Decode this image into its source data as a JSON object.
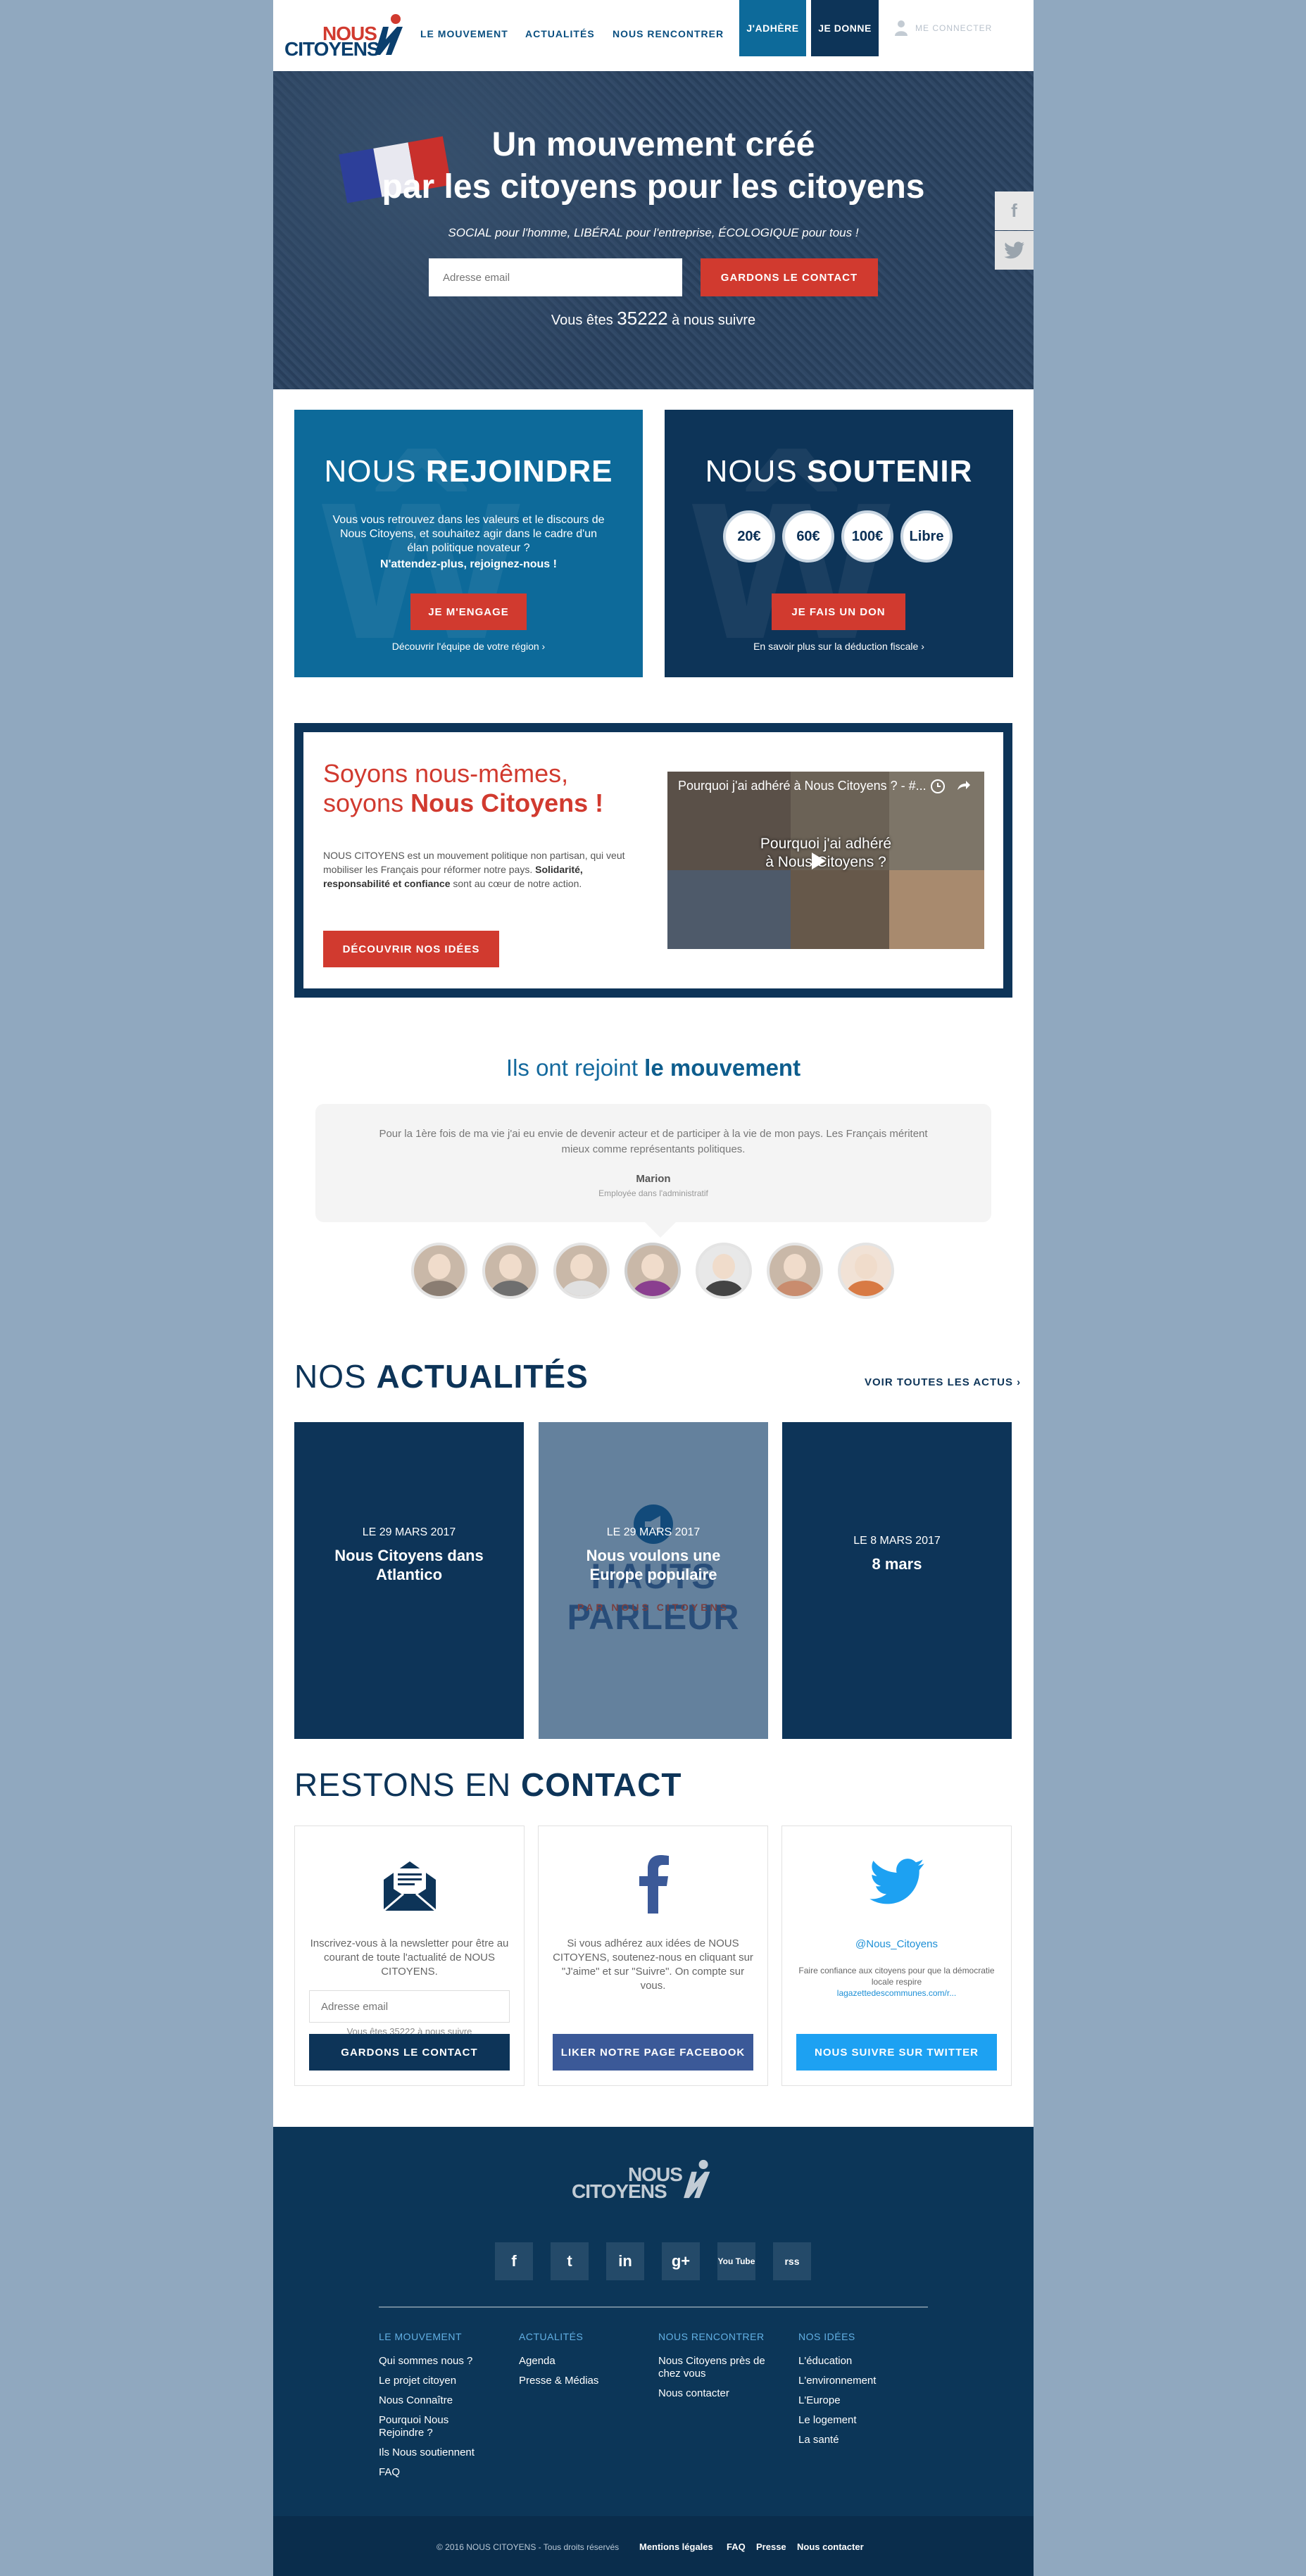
{
  "nav": {
    "logo_line1": "NOUS",
    "logo_line2": "CITOYENS",
    "links": [
      "LE MOUVEMENT",
      "ACTUALITÉS",
      "NOUS RENCONTRER"
    ],
    "adhere": "J'ADHÈRE",
    "donne": "JE DONNE",
    "login": "ME CONNECTER"
  },
  "hero": {
    "title_line1": "Un mouvement créé",
    "title_line2": "par les citoyens pour les citoyens",
    "subtitle": "SOCIAL pour l'homme, LIBÉRAL pour l'entreprise, ÉCOLOGIQUE pour tous !",
    "email_placeholder": "Adresse email",
    "cta": "GARDONS LE CONTACT",
    "count_prefix": "Vous êtes",
    "count": "35222",
    "count_suffix": "à nous suivre"
  },
  "share": {
    "facebook": "f",
    "twitter": "t"
  },
  "join": {
    "title_light": "NOUS",
    "title_bold": "REJOINDRE",
    "text": "Vous vous retrouvez dans les valeurs et le discours de Nous Citoyens, et souhaitez agir dans le cadre d'un élan politique novateur ?",
    "emphasis": "N'attendez-plus, rejoignez-nous !",
    "button": "JE M'ENGAGE",
    "link": "Découvrir l'équipe de votre région ›"
  },
  "support": {
    "title_light": "NOUS",
    "title_bold": "SOUTENIR",
    "amounts": [
      "20€",
      "60€",
      "100€",
      "Libre"
    ],
    "button": "JE FAIS UN DON",
    "link": "En savoir plus sur la déduction fiscale ›"
  },
  "intro": {
    "title_line1": "Soyons nous-mêmes,",
    "title_line2_light": "soyons",
    "title_line2_bold": "Nous Citoyens !",
    "text": "NOUS CITOYENS est un mouvement politique non partisan, qui veut mobiliser les Français pour réformer notre pays.",
    "text_bold": "Solidarité, responsabilité et confiance",
    "text_end": "sont au cœur de notre action.",
    "button": "DÉCOUVRIR NOS IDÉES",
    "video_title": "Pourquoi j'ai adhéré à Nous Citoyens ? - #...",
    "video_center_1": "Pourquoi j'ai adhéré",
    "video_center_2": "à Nous Citoyens ?"
  },
  "testimonials": {
    "title_light": "Ils ont rejoint",
    "title_bold": "le mouvement",
    "quote": "Pour la 1ère fois de ma vie j'ai eu envie de devenir acteur et de participer à la vie de mon pays. Les Français méritent mieux comme représentants politiques.",
    "name": "Marion",
    "role": "Employée dans l'administratif"
  },
  "news": {
    "title_light": "NOS",
    "title_bold": "ACTUALITÉS",
    "see_all": "VOIR TOUTES LES ACTUS ›",
    "items": [
      {
        "date": "LE 29 MARS 2017",
        "title": "Nous Citoyens dans Atlantico"
      },
      {
        "date": "LE 29 MARS 2017",
        "title": "Nous voulons une Europe populaire",
        "watermark": "HAUTS PARLEUR",
        "watermark_sub": "PAR NOUS CITOYENS"
      },
      {
        "date": "LE 8 MARS 2017",
        "title": "8 mars"
      }
    ]
  },
  "contact": {
    "title_light": "RESTONS EN",
    "title_bold": "CONTACT",
    "newsletter_text": "Inscrivez-vous à la newsletter pour être au courant de toute l'actualité de NOUS CITOYENS.",
    "email_placeholder": "Adresse email",
    "newsletter_count": "Vous êtes 35222 à nous suivre",
    "newsletter_button": "GARDONS LE CONTACT",
    "facebook_text": "Si vous adhérez aux idées de NOUS CITOYENS, soutenez-nous en cliquant sur \"J'aime\" et sur \"Suivre\". On compte sur vous.",
    "facebook_button": "LIKER NOTRE PAGE FACEBOOK",
    "twitter_handle": "@Nous_Citoyens",
    "twitter_text": "Faire confiance aux citoyens pour que la démocratie locale respire",
    "twitter_link": "lagazettedescommunes.com/r...",
    "twitter_button": "NOUS SUIVRE SUR TWITTER"
  },
  "footer": {
    "social": [
      "f",
      "t",
      "in",
      "g+",
      "You Tube",
      "rss"
    ],
    "columns": [
      {
        "heading": "LE MOUVEMENT",
        "items": [
          "Qui sommes nous ?",
          "Le projet citoyen",
          "Nous Connaître",
          "Pourquoi Nous Rejoindre ?",
          "Ils Nous soutiennent",
          "FAQ"
        ]
      },
      {
        "heading": "ACTUALITÉS",
        "items": [
          "Agenda",
          "Presse & Médias"
        ]
      },
      {
        "heading": "NOUS RENCONTRER",
        "items": [
          "Nous Citoyens près de chez vous",
          "Nous contacter"
        ]
      },
      {
        "heading": "NOS IDÉES",
        "items": [
          "L'éducation",
          "L'environnement",
          "L'Europe",
          "Le logement",
          "La santé"
        ]
      }
    ],
    "copyright": "© 2016 NOUS CITOYENS - Tous droits réservés",
    "links": [
      "Mentions légales",
      "FAQ",
      "Presse",
      "Nous contacter"
    ]
  },
  "colors": {
    "red": "#d13a2f",
    "navy": "#0d3458",
    "blue": "#0d6a9a",
    "facebook": "#3b5998",
    "twitter": "#1da1f2"
  }
}
